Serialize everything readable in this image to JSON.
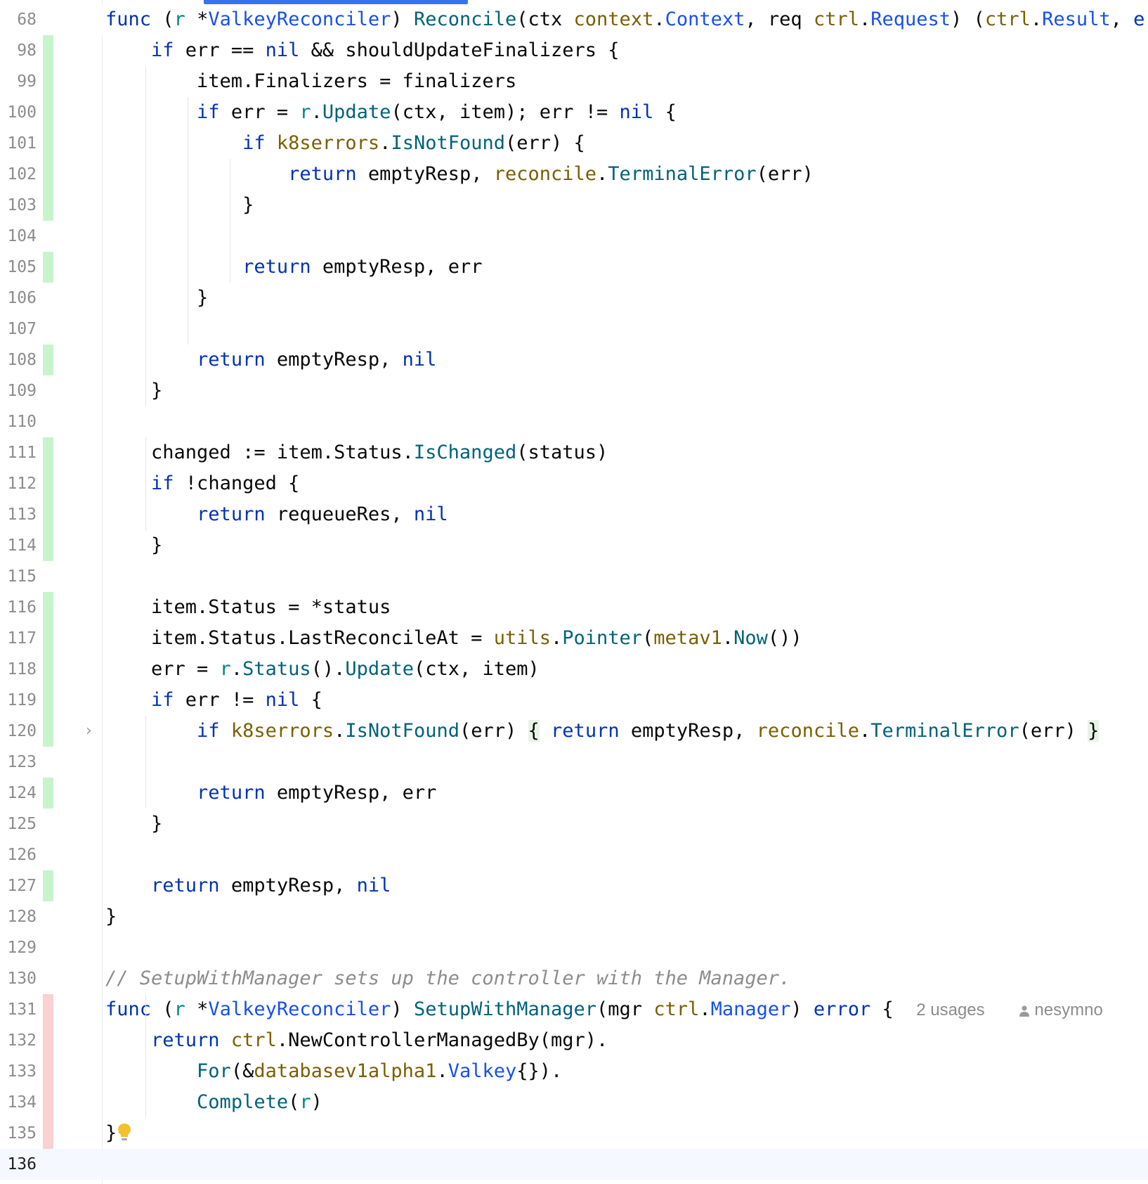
{
  "editor": {
    "sticky": {
      "number": "68",
      "tokens": [
        [
          "kw",
          "func"
        ],
        [
          "p",
          " ("
        ],
        [
          "rcv",
          "r"
        ],
        [
          "p",
          " *"
        ],
        [
          "ty",
          "ValkeyReconciler"
        ],
        [
          "p",
          ") "
        ],
        [
          "fn",
          "Reconcile"
        ],
        [
          "p",
          "(ctx "
        ],
        [
          "pkg",
          "context"
        ],
        [
          "p",
          "."
        ],
        [
          "ty",
          "Context"
        ],
        [
          "p",
          ", req "
        ],
        [
          "pkg",
          "ctrl"
        ],
        [
          "p",
          "."
        ],
        [
          "ty",
          "Request"
        ],
        [
          "p",
          ") ("
        ],
        [
          "pkg",
          "ctrl"
        ],
        [
          "p",
          "."
        ],
        [
          "ty",
          "Result"
        ],
        [
          "p",
          ", "
        ],
        [
          "kw",
          "error"
        ]
      ]
    },
    "lines": [
      {
        "number": "98",
        "change": "added",
        "tokens": [
          [
            "p",
            "    "
          ],
          [
            "kw",
            "if"
          ],
          [
            "p",
            " err == "
          ],
          [
            "kw",
            "nil"
          ],
          [
            "p",
            " && shouldUpdateFinalizers {"
          ]
        ]
      },
      {
        "number": "99",
        "change": "added",
        "tokens": [
          [
            "p",
            "        item.Finalizers = finalizers"
          ]
        ]
      },
      {
        "number": "100",
        "change": "added",
        "tokens": [
          [
            "p",
            "        "
          ],
          [
            "kw",
            "if"
          ],
          [
            "p",
            " err = "
          ],
          [
            "rcv",
            "r"
          ],
          [
            "p",
            "."
          ],
          [
            "fn",
            "Update"
          ],
          [
            "p",
            "(ctx, item); err != "
          ],
          [
            "kw",
            "nil"
          ],
          [
            "p",
            " {"
          ]
        ]
      },
      {
        "number": "101",
        "change": "added",
        "tokens": [
          [
            "p",
            "            "
          ],
          [
            "kw",
            "if"
          ],
          [
            "p",
            " "
          ],
          [
            "pkg",
            "k8serrors"
          ],
          [
            "p",
            "."
          ],
          [
            "fn",
            "IsNotFound"
          ],
          [
            "p",
            "(err) {"
          ]
        ]
      },
      {
        "number": "102",
        "change": "added",
        "tokens": [
          [
            "p",
            "                "
          ],
          [
            "kw",
            "return"
          ],
          [
            "p",
            " emptyResp, "
          ],
          [
            "pkg",
            "reconcile"
          ],
          [
            "p",
            "."
          ],
          [
            "fn",
            "TerminalError"
          ],
          [
            "p",
            "(err)"
          ]
        ]
      },
      {
        "number": "103",
        "change": "added",
        "tokens": [
          [
            "p",
            "            }"
          ]
        ]
      },
      {
        "number": "104",
        "change": "none",
        "tokens": []
      },
      {
        "number": "105",
        "change": "added",
        "tokens": [
          [
            "p",
            "            "
          ],
          [
            "kw",
            "return"
          ],
          [
            "p",
            " emptyResp, err"
          ]
        ]
      },
      {
        "number": "106",
        "change": "none",
        "tokens": [
          [
            "p",
            "        }"
          ]
        ]
      },
      {
        "number": "107",
        "change": "none",
        "tokens": []
      },
      {
        "number": "108",
        "change": "added",
        "tokens": [
          [
            "p",
            "        "
          ],
          [
            "kw",
            "return"
          ],
          [
            "p",
            " emptyResp, "
          ],
          [
            "kw",
            "nil"
          ]
        ]
      },
      {
        "number": "109",
        "change": "none",
        "tokens": [
          [
            "p",
            "    }"
          ]
        ]
      },
      {
        "number": "110",
        "change": "none",
        "tokens": []
      },
      {
        "number": "111",
        "change": "added",
        "tokens": [
          [
            "p",
            "    changed := item.Status."
          ],
          [
            "fn",
            "IsChanged"
          ],
          [
            "p",
            "(status)"
          ]
        ]
      },
      {
        "number": "112",
        "change": "added",
        "tokens": [
          [
            "p",
            "    "
          ],
          [
            "kw",
            "if"
          ],
          [
            "p",
            " !changed {"
          ]
        ]
      },
      {
        "number": "113",
        "change": "added",
        "tokens": [
          [
            "p",
            "        "
          ],
          [
            "kw",
            "return"
          ],
          [
            "p",
            " requeueRes, "
          ],
          [
            "kw",
            "nil"
          ]
        ]
      },
      {
        "number": "114",
        "change": "added",
        "tokens": [
          [
            "p",
            "    }"
          ]
        ]
      },
      {
        "number": "115",
        "change": "none",
        "tokens": []
      },
      {
        "number": "116",
        "change": "added",
        "tokens": [
          [
            "p",
            "    item.Status = *status"
          ]
        ]
      },
      {
        "number": "117",
        "change": "added",
        "tokens": [
          [
            "p",
            "    item.Status.LastReconcileAt = "
          ],
          [
            "pkg",
            "utils"
          ],
          [
            "p",
            "."
          ],
          [
            "fn",
            "Pointer"
          ],
          [
            "p",
            "("
          ],
          [
            "pkg",
            "metav1"
          ],
          [
            "p",
            "."
          ],
          [
            "fn",
            "Now"
          ],
          [
            "p",
            "())"
          ]
        ]
      },
      {
        "number": "118",
        "change": "added",
        "tokens": [
          [
            "p",
            "    err = "
          ],
          [
            "rcv",
            "r"
          ],
          [
            "p",
            "."
          ],
          [
            "fn",
            "Status"
          ],
          [
            "p",
            "()."
          ],
          [
            "fn",
            "Update"
          ],
          [
            "p",
            "(ctx, item)"
          ]
        ]
      },
      {
        "number": "119",
        "change": "added",
        "tokens": [
          [
            "p",
            "    "
          ],
          [
            "kw",
            "if"
          ],
          [
            "p",
            " err != "
          ],
          [
            "kw",
            "nil"
          ],
          [
            "p",
            " {"
          ]
        ]
      },
      {
        "number": "120",
        "change": "added",
        "folded": true,
        "tokens": [
          [
            "p",
            "        "
          ],
          [
            "kw",
            "if"
          ],
          [
            "p",
            " "
          ],
          [
            "pkg",
            "k8serrors"
          ],
          [
            "p",
            "."
          ],
          [
            "fn",
            "IsNotFound"
          ],
          [
            "p",
            "(err) "
          ],
          [
            "hl",
            "{"
          ],
          [
            "p",
            " "
          ],
          [
            "kw",
            "return"
          ],
          [
            "p",
            " emptyResp, "
          ],
          [
            "pkg",
            "reconcile"
          ],
          [
            "p",
            "."
          ],
          [
            "fn",
            "TerminalError"
          ],
          [
            "p",
            "(err) "
          ],
          [
            "hl",
            "}"
          ]
        ]
      },
      {
        "number": "123",
        "change": "none",
        "tokens": []
      },
      {
        "number": "124",
        "change": "added",
        "tokens": [
          [
            "p",
            "        "
          ],
          [
            "kw",
            "return"
          ],
          [
            "p",
            " emptyResp, err"
          ]
        ]
      },
      {
        "number": "125",
        "change": "none",
        "tokens": [
          [
            "p",
            "    }"
          ]
        ]
      },
      {
        "number": "126",
        "change": "none",
        "tokens": []
      },
      {
        "number": "127",
        "change": "added",
        "tokens": [
          [
            "p",
            "    "
          ],
          [
            "kw",
            "return"
          ],
          [
            "p",
            " emptyResp, "
          ],
          [
            "kw",
            "nil"
          ]
        ]
      },
      {
        "number": "128",
        "change": "none",
        "tokens": [
          [
            "p",
            "}"
          ]
        ]
      },
      {
        "number": "129",
        "change": "none",
        "tokens": []
      },
      {
        "number": "130",
        "change": "none",
        "tokens": [
          [
            "cmt",
            "// SetupWithManager sets up the controller with the Manager."
          ]
        ]
      },
      {
        "number": "131",
        "change": "removed",
        "tokens": [
          [
            "kw",
            "func"
          ],
          [
            "p",
            " ("
          ],
          [
            "rcv",
            "r"
          ],
          [
            "p",
            " *"
          ],
          [
            "ty",
            "ValkeyReconciler"
          ],
          [
            "p",
            ") "
          ],
          [
            "fn",
            "SetupWithManager"
          ],
          [
            "p",
            "(mgr "
          ],
          [
            "pkg",
            "ctrl"
          ],
          [
            "p",
            "."
          ],
          [
            "ty",
            "Manager"
          ],
          [
            "p",
            ") "
          ],
          [
            "kw",
            "error"
          ],
          [
            "p",
            " {  "
          ]
        ],
        "hint": {
          "usages": "2 usages",
          "author": "nesymno"
        }
      },
      {
        "number": "132",
        "change": "removed",
        "tokens": [
          [
            "p",
            "    "
          ],
          [
            "kw",
            "return"
          ],
          [
            "p",
            " "
          ],
          [
            "pkg",
            "ctrl"
          ],
          [
            "p",
            ".NewControllerManagedBy(mgr)."
          ]
        ]
      },
      {
        "number": "133",
        "change": "removed",
        "tokens": [
          [
            "p",
            "        "
          ],
          [
            "fn",
            "For"
          ],
          [
            "p",
            "(&"
          ],
          [
            "pkg",
            "databasev1alpha1"
          ],
          [
            "p",
            "."
          ],
          [
            "ty",
            "Valkey"
          ],
          [
            "p",
            "{})."
          ]
        ]
      },
      {
        "number": "134",
        "change": "removed",
        "tokens": [
          [
            "p",
            "        "
          ],
          [
            "fn",
            "Complete"
          ],
          [
            "p",
            "("
          ],
          [
            "rcv",
            "r"
          ],
          [
            "p",
            ")"
          ]
        ]
      },
      {
        "number": "135",
        "change": "removed",
        "bulb": true,
        "tokens": [
          [
            "p",
            "}"
          ]
        ]
      },
      {
        "number": "136",
        "change": "none",
        "current": true,
        "tokens": []
      }
    ]
  }
}
